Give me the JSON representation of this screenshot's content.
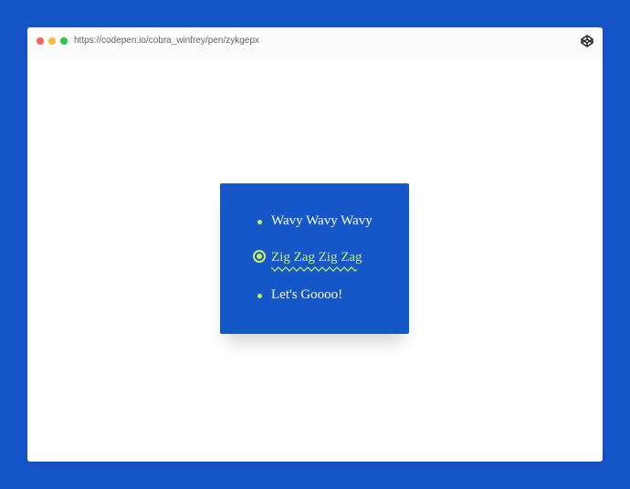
{
  "browser": {
    "url": "https://codepen.io/cobra_winfrey/pen/zykgepx",
    "icon": "codepen-icon",
    "traffic_lights": [
      {
        "name": "close",
        "color": "#FF5F57"
      },
      {
        "name": "minimize",
        "color": "#FEBC2E"
      },
      {
        "name": "maximize",
        "color": "#28C840"
      }
    ]
  },
  "menu": {
    "items": [
      {
        "label": "Wavy Wavy Wavy",
        "active": false
      },
      {
        "label": "Zig Zag Zig Zag",
        "active": true
      },
      {
        "label": "Let's Goooo!",
        "active": false
      }
    ]
  },
  "colors": {
    "page_background": "#1556C9",
    "card_background": "#1556C9",
    "accent": "#C6F25E",
    "text": "#FFFFFF"
  }
}
